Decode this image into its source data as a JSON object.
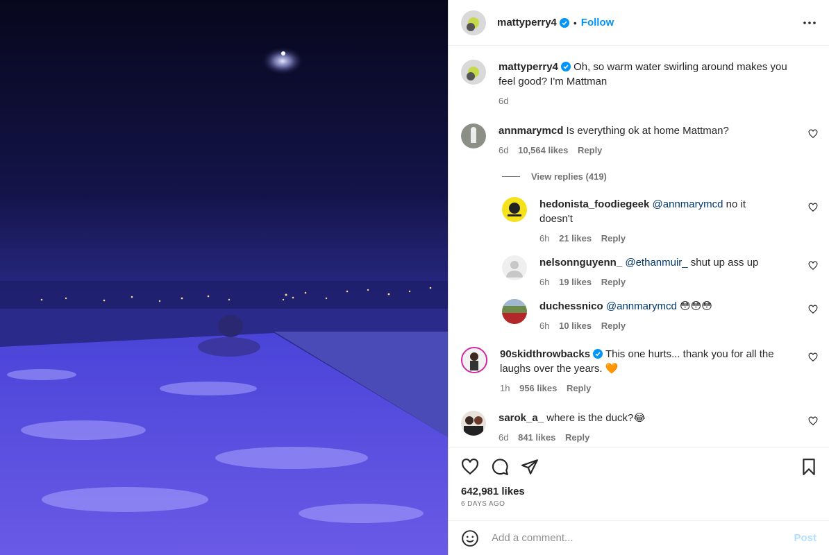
{
  "post": {
    "author": "mattyperry4",
    "follow_label": "Follow",
    "separator": "•",
    "caption": "Oh, so warm water swirling around makes you feel good? I'm Mattman",
    "caption_time": "6d",
    "likes_total": "642,981 likes",
    "time_ago": "6 DAYS AGO"
  },
  "comments": [
    {
      "user": "annmarymcd",
      "text": "Is everything ok at home Mattman?",
      "time": "6d",
      "likes": "10,564 likes",
      "reply": "Reply",
      "view_replies": "View replies (419)",
      "replies": [
        {
          "user": "hedonista_foodiegeek",
          "mention": "@annmarymcd",
          "text": " no it doesn't",
          "time": "6h",
          "likes": "21 likes",
          "reply": "Reply"
        },
        {
          "user": "nelsonnguyenn_",
          "mention": "@ethanmuir_",
          "text": " shut up ass up",
          "time": "6h",
          "likes": "19 likes",
          "reply": "Reply"
        },
        {
          "user": "duchessnico",
          "mention": "@annmarymcd",
          "text": " 😳😳😳",
          "time": "6h",
          "likes": "10 likes",
          "reply": "Reply"
        }
      ]
    },
    {
      "user": "90skidthrowbacks",
      "text": "This one hurts... thank you for all the laughs over the years. 🧡",
      "time": "1h",
      "likes": "956 likes",
      "reply": "Reply",
      "verified": true
    },
    {
      "user": "sarok_a_",
      "text": "where is the duck?😂",
      "time": "6d",
      "likes": "841 likes",
      "reply": "Reply"
    }
  ],
  "composer": {
    "placeholder": "Add a comment...",
    "post_label": "Post"
  },
  "icons": {
    "more": "more-options-icon",
    "like": "heart-icon",
    "comment": "comment-icon",
    "share": "share-icon",
    "save": "bookmark-icon",
    "emoji": "emoji-icon",
    "verified": "verified-badge-icon"
  },
  "colors": {
    "link": "#0095f6",
    "mention": "#00376b",
    "muted": "#737373",
    "post_disabled": "#b2dffc"
  }
}
